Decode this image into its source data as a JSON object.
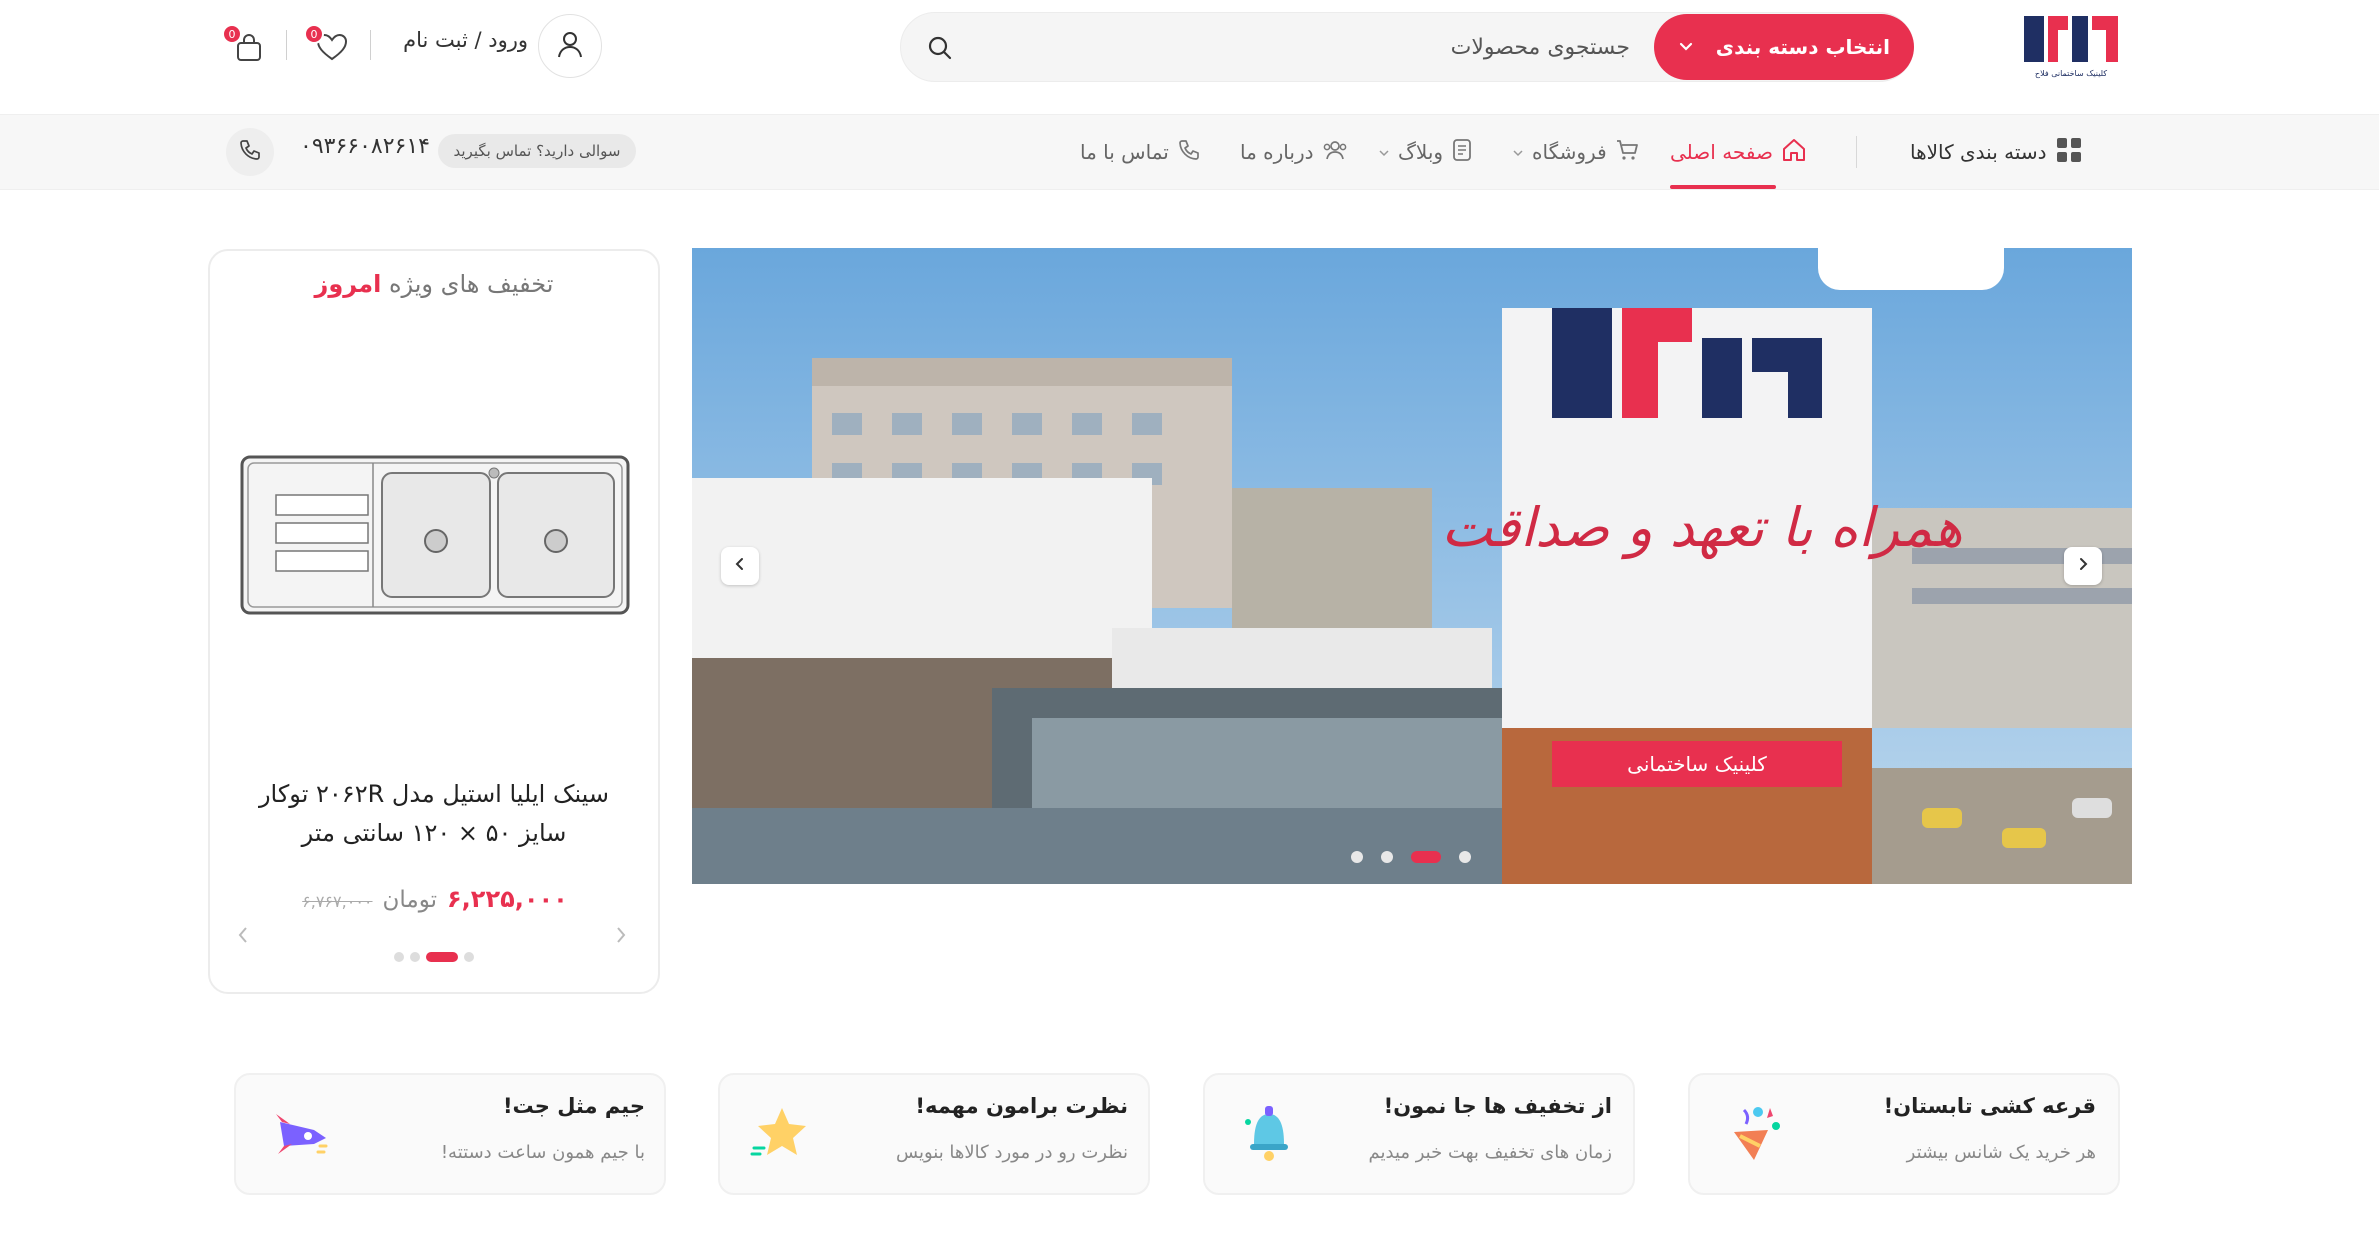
{
  "header": {
    "logo_text": "فلاح",
    "logo_tagline": "کلینیک ساختمانی فلاح",
    "category_button": "انتخاب دسته بندی",
    "search_placeholder": "جستجوی محصولات",
    "login_label": "ورود / ثبت نام",
    "wishlist_count": "0",
    "cart_count": "0"
  },
  "nav": {
    "categories": "دسته بندی کالاها",
    "home": "صفحه اصلی",
    "shop": "فروشگاه",
    "blog": "وبلاگ",
    "about": "درباره ما",
    "contact": "تماس با ما",
    "ask_text": "سوالی دارید؟ تماس بگیرید",
    "phone": "۰۹۳۶۶۰۸۲۶۱۴"
  },
  "slider": {
    "sign_brand": "فلاح",
    "sign_slogan": "همراه با تعهد و صداقت",
    "sign_banner": "کلینیک ساختمانی",
    "active_dot": 2,
    "dot_count": 4
  },
  "offer": {
    "title_prefix": "تخفیف های ویژه",
    "title_highlight": "امروز",
    "product_name": "سینک ایلیا استیل مدل ۲۰۶۲R توکار سایز ۵۰ × ۱۲۰ سانتی متر",
    "price_new": "۶,۲۲۵,۰۰۰",
    "price_unit": "تومان",
    "price_old": "۶,۷۶۷,۰۰۰",
    "active_dot": 1
  },
  "features": [
    {
      "title": "قرعه کشی تابستان!",
      "subtitle": "هر خرید یک شانس بیشتر",
      "icon": "party-popper-icon"
    },
    {
      "title": "از تخفیف ها جا نمون!",
      "subtitle": "زمان های تخفیف بهت خبر میدیم",
      "icon": "bell-icon"
    },
    {
      "title": "نظرت برامون مهمه!",
      "subtitle": "نظرت رو در مورد کالاها بنویس",
      "icon": "star-icon"
    },
    {
      "title": "جیم مثل جت!",
      "subtitle": "با جیم همون ساعت دستته!",
      "icon": "rocket-icon"
    }
  ],
  "colors": {
    "accent": "#e8304f",
    "brand_blue": "#1f2f63"
  }
}
